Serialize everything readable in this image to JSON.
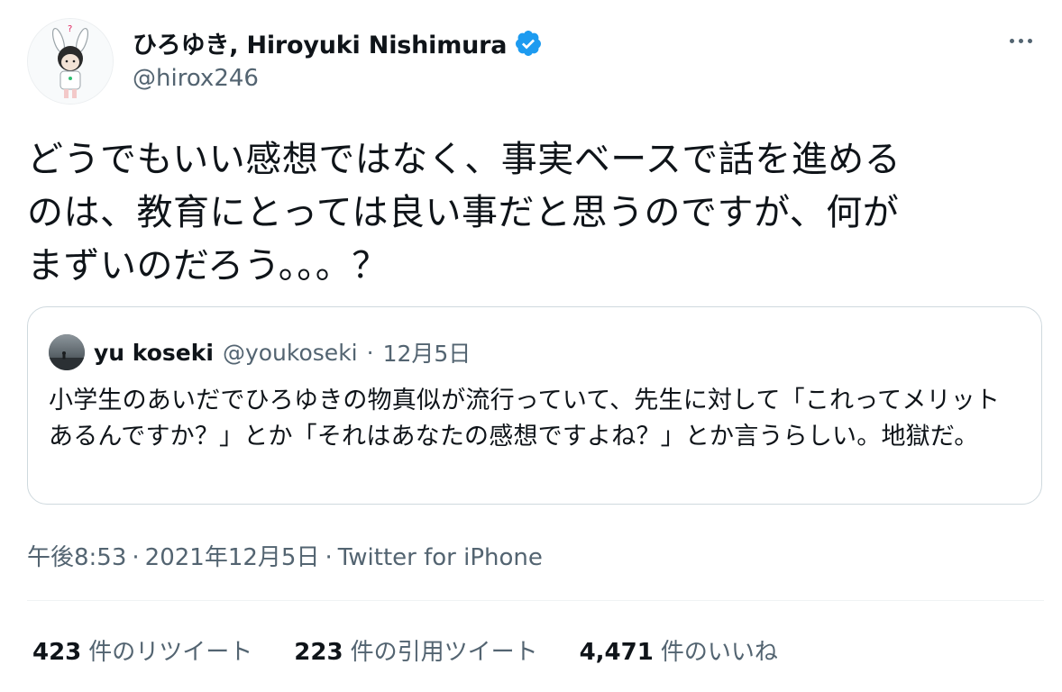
{
  "author": {
    "display_name": "ひろゆき, Hiroyuki Nishimura",
    "handle": "@hirox246",
    "verified": true,
    "verified_color": "#1d9bf0"
  },
  "tweet": {
    "text": "どうでもいい感想ではなく、事実ベースで話を進める\nのは、教育にとっては良い事だと思うのですが、何が\nまずいのだろう。。。？"
  },
  "quote": {
    "display_name": "yu koseki",
    "handle": "@youkoseki",
    "separator": "·",
    "date": "12月5日",
    "text": "小学生のあいだでひろゆきの物真似が流行っていて、先生に対して「これってメリットあるんですか？」とか「それはあなたの感想ですよね？」とか言うらしい。地獄だ。"
  },
  "meta": {
    "time": "午後8:53",
    "separator": "·",
    "date": "2021年12月5日",
    "source": "Twitter for iPhone"
  },
  "stats": {
    "retweets": {
      "count": "423",
      "label": "件のリツイート"
    },
    "quotes": {
      "count": "223",
      "label": "件の引用ツイート"
    },
    "likes": {
      "count": "4,471",
      "label": "件のいいね"
    }
  },
  "icons": {
    "more": "more-horizontal-icon",
    "verified": "verified-badge-icon"
  },
  "colors": {
    "text_primary": "#0f1419",
    "text_secondary": "#536471",
    "border": "#cfd9de",
    "accent": "#1d9bf0"
  }
}
